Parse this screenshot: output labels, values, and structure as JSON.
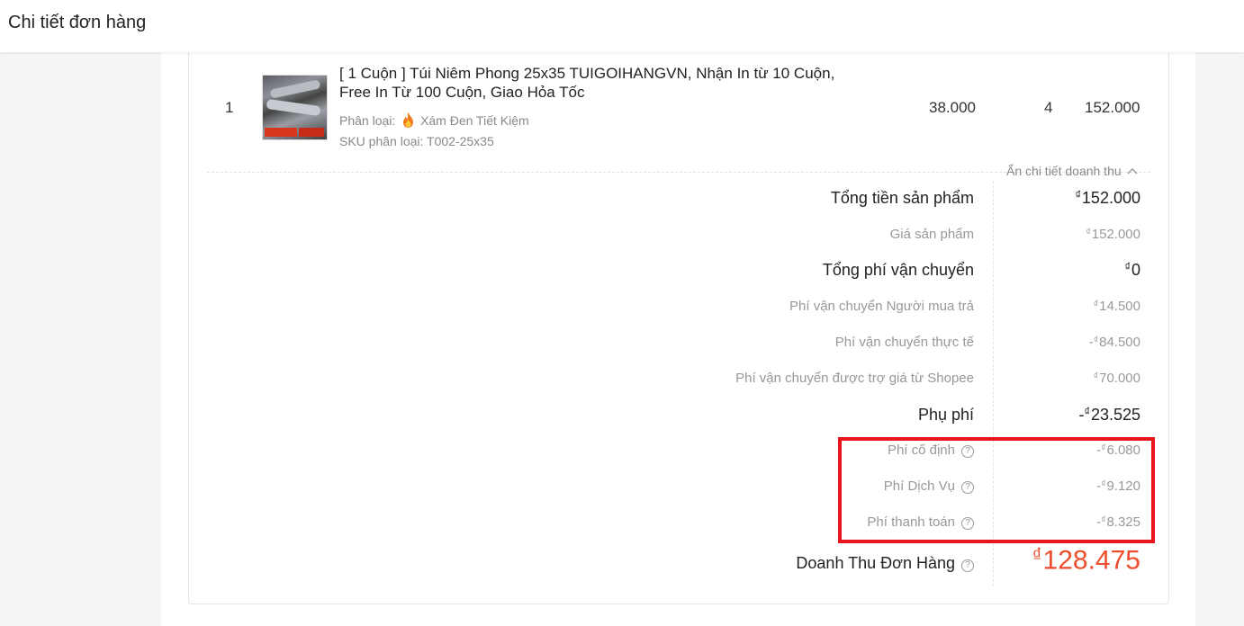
{
  "header": {
    "title": "Chi tiết đơn hàng"
  },
  "product": {
    "index": "1",
    "name": "[ 1 Cuộn ] Túi Niêm Phong 25x35 TUIGOIHANGVN, Nhận In từ 10 Cuộn, Free In Từ 100 Cuộn, Giao Hỏa Tốc",
    "variant_label": "Phân loại:",
    "variant_value": "Xám Đen Tiết Kiệm",
    "sku": "SKU phân loại: T002-25x35",
    "unit_price": "38.000",
    "quantity": "4",
    "subtotal": "152.000"
  },
  "revenue": {
    "toggle_label": "Ẩn chi tiết doanh thu",
    "currency": "₫",
    "rows": [
      {
        "label": "Tổng tiền sản phẩm",
        "value": "152.000",
        "sign": "",
        "level": "main"
      },
      {
        "label": "Giá sản phẩm",
        "value": "152.000",
        "sign": "",
        "level": "sub"
      },
      {
        "label": "Tổng phí vận chuyển",
        "value": "0",
        "sign": "",
        "level": "main"
      },
      {
        "label": "Phí vận chuyển Người mua trả",
        "value": "14.500",
        "sign": "",
        "level": "sub"
      },
      {
        "label": "Phí vận chuyển thực tế",
        "value": "84.500",
        "sign": "-",
        "level": "sub"
      },
      {
        "label": "Phí vận chuyển được trợ giá từ Shopee",
        "value": "70.000",
        "sign": "",
        "level": "sub"
      },
      {
        "label": "Phụ phí",
        "value": "23.525",
        "sign": "-",
        "level": "main"
      },
      {
        "label": "Phí cố định",
        "value": "6.080",
        "sign": "-",
        "level": "sub",
        "help": true
      },
      {
        "label": "Phí Dịch Vụ",
        "value": "9.120",
        "sign": "-",
        "level": "sub",
        "help": true
      },
      {
        "label": "Phí thanh toán",
        "value": "8.325",
        "sign": "-",
        "level": "sub",
        "help": true
      }
    ],
    "total_label": "Doanh Thu Đơn Hàng",
    "total_value": "128.475"
  },
  "colors": {
    "accent": "#ee4d2d",
    "highlight": "#e8161c"
  },
  "icons": {
    "help": "question-circle-icon",
    "toggle": "chevron-up-icon",
    "variant": "fire-icon"
  }
}
